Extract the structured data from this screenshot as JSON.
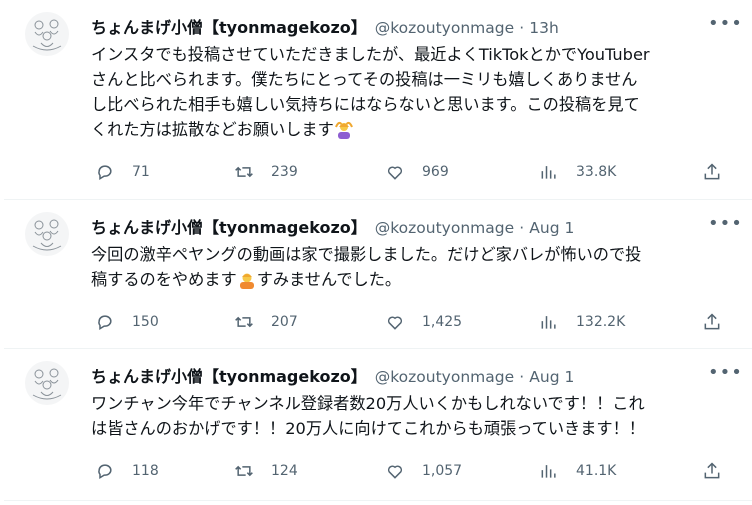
{
  "tweets": [
    {
      "name": "ちょんまげ小僧【tyonmagekozo】",
      "handle": "@kozoutyonmage",
      "separator": "·",
      "time": "13h",
      "lines": [
        "インスタでも投稿させていただきましたが、最近よくTikTokとかでYouTuber",
        "さんと比べられます。僕たちにとってその投稿は一ミリも嬉しくありません",
        "し比べられた相手も嬉しい気持ちにはならないと思います。この投稿を見て",
        "くれた方は拡散などお願いします"
      ],
      "emoji": "person-gesturing-ok",
      "replies": "71",
      "retweets": "239",
      "likes": "969",
      "views": "33.8K"
    },
    {
      "name": "ちょんまげ小僧【tyonmagekozo】",
      "handle": "@kozoutyonmage",
      "separator": "·",
      "time": "Aug 1",
      "line1": "今回の激辛ペヤングの動画は家で撮影しました。だけど家バレが怖いので投",
      "line2a": "稿するのをやめます",
      "line2b": "すみませんでした。",
      "emoji": "person-bowing",
      "replies": "150",
      "retweets": "207",
      "likes": "1,425",
      "views": "132.2K"
    },
    {
      "name": "ちょんまげ小僧【tyonmagekozo】",
      "handle": "@kozoutyonmage",
      "separator": "·",
      "time": "Aug 1",
      "lines": [
        "ワンチャン今年でチャンネル登録者数20万人いくかもしれないです！！これ",
        "は皆さんのおかげです！！20万人に向けてこれからも頑張っていきます！！"
      ],
      "replies": "118",
      "retweets": "124",
      "likes": "1,057",
      "views": "41.1K"
    }
  ],
  "icons": {
    "more": "more-icon",
    "reply": "reply-icon",
    "retweet": "retweet-icon",
    "like": "like-icon",
    "views": "views-icon",
    "share": "share-icon"
  },
  "colors": {
    "text": "#0f1419",
    "secondary": "#536471",
    "border": "#eff3f4",
    "emoji_skin": "#f7c948",
    "emoji_shirt": "#8e5fd1"
  }
}
